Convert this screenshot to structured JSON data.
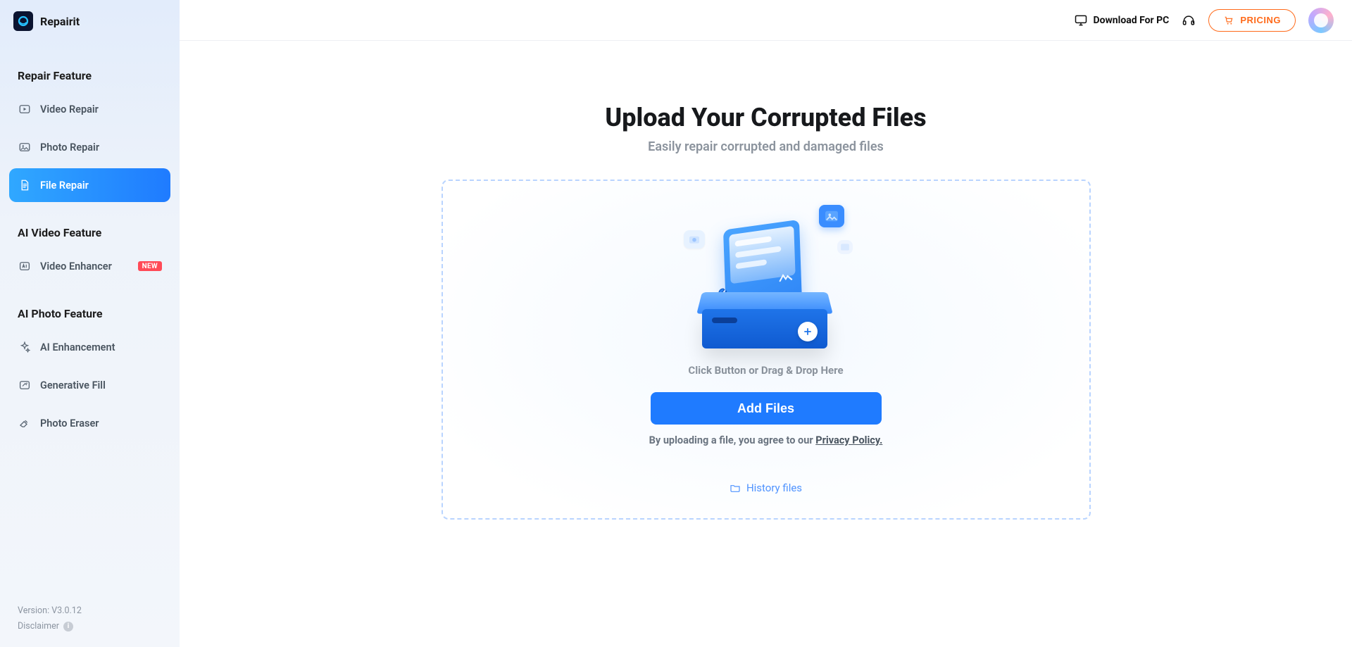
{
  "brand": {
    "name": "Repairit"
  },
  "sidebar": {
    "sections": [
      {
        "title": "Repair Feature",
        "items": [
          {
            "id": "video-repair",
            "label": "Video Repair"
          },
          {
            "id": "photo-repair",
            "label": "Photo Repair"
          },
          {
            "id": "file-repair",
            "label": "File Repair",
            "active": true
          }
        ]
      },
      {
        "title": "AI Video Feature",
        "items": [
          {
            "id": "video-enhancer",
            "label": "Video Enhancer",
            "badge": "NEW"
          }
        ]
      },
      {
        "title": "AI Photo Feature",
        "items": [
          {
            "id": "ai-enhancement",
            "label": "AI Enhancement"
          },
          {
            "id": "generative-fill",
            "label": "Generative Fill"
          },
          {
            "id": "photo-eraser",
            "label": "Photo Eraser"
          }
        ]
      }
    ],
    "footer": {
      "version": "Version: V3.0.12",
      "disclaimer": "Disclaimer"
    }
  },
  "topbar": {
    "download_label": "Download For PC",
    "pricing_label": "PRICING"
  },
  "hero": {
    "title": "Upload Your Corrupted Files",
    "subtitle": "Easily repair corrupted and damaged files"
  },
  "dropzone": {
    "hint": "Click Button or Drag & Drop Here",
    "add_files_label": "Add Files",
    "agree_prefix": "By uploading a file, you agree to our ",
    "privacy_label": "Privacy Policy.",
    "history_label": "History files"
  }
}
